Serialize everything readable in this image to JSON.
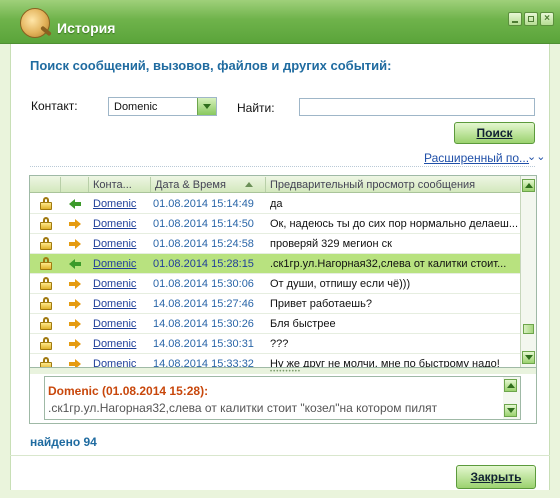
{
  "window": {
    "title": "История"
  },
  "heading": "Поиск сообщений, вызовов, файлов и других событий:",
  "filters": {
    "contact_label": "Контакт:",
    "contact_value": "Domenic",
    "find_label": "Найти:",
    "find_value": "",
    "search_button": "Поиск",
    "advanced_link": "Расширенный по..."
  },
  "table": {
    "columns": [
      "Конта...",
      "Дата & Время",
      "Предварительный просмотр сообщения"
    ],
    "rows": [
      {
        "direction": "in",
        "contact": "Domenic",
        "datetime": "01.08.2014 15:14:49",
        "message": "да",
        "selected": false
      },
      {
        "direction": "out",
        "contact": "Domenic",
        "datetime": "01.08.2014 15:14:50",
        "message": "Ок, надеюсь ты до сих пор нормально делаеш...",
        "selected": false
      },
      {
        "direction": "out",
        "contact": "Domenic",
        "datetime": "01.08.2014 15:24:58",
        "message": "проверяй 329 мегион ск",
        "selected": false
      },
      {
        "direction": "in",
        "contact": "Domenic",
        "datetime": "01.08.2014 15:28:15",
        "message": ".ск1гр.ул.Нагорная32,слева от калитки стоит...",
        "selected": true
      },
      {
        "direction": "out",
        "contact": "Domenic",
        "datetime": "01.08.2014 15:30:06",
        "message": "От души, отпишу если чё)))",
        "selected": false
      },
      {
        "direction": "out",
        "contact": "Domenic",
        "datetime": "14.08.2014 15:27:46",
        "message": "Привет работаешь?",
        "selected": false
      },
      {
        "direction": "out",
        "contact": "Domenic",
        "datetime": "14.08.2014 15:30:26",
        "message": "Бля быстрее",
        "selected": false
      },
      {
        "direction": "out",
        "contact": "Domenic",
        "datetime": "14.08.2014 15:30:31",
        "message": "???",
        "selected": false
      },
      {
        "direction": "out",
        "contact": "Domenic",
        "datetime": "14.08.2014 15:33:32",
        "message": "Ну же друг не молчи, мне по быстрому надо!",
        "selected": false
      }
    ]
  },
  "preview": {
    "header": "Domenic (01.08.2014 15:28):",
    "text": ".ск1гр.ул.Нагорная32,слева от калитки стоит \"козел\"на котором пилят"
  },
  "status": {
    "found": "найдено 94"
  },
  "close_button": "Закрыть",
  "colors": {
    "accent_green": "#6fb34b",
    "selected_row": "#b8e27f",
    "heading_blue": "#1f6ba0",
    "preview_header": "#c8470b"
  },
  "icons": {
    "lock": "lock-icon",
    "incoming": "arrow-left-green-icon",
    "outgoing": "arrow-right-orange-icon"
  }
}
